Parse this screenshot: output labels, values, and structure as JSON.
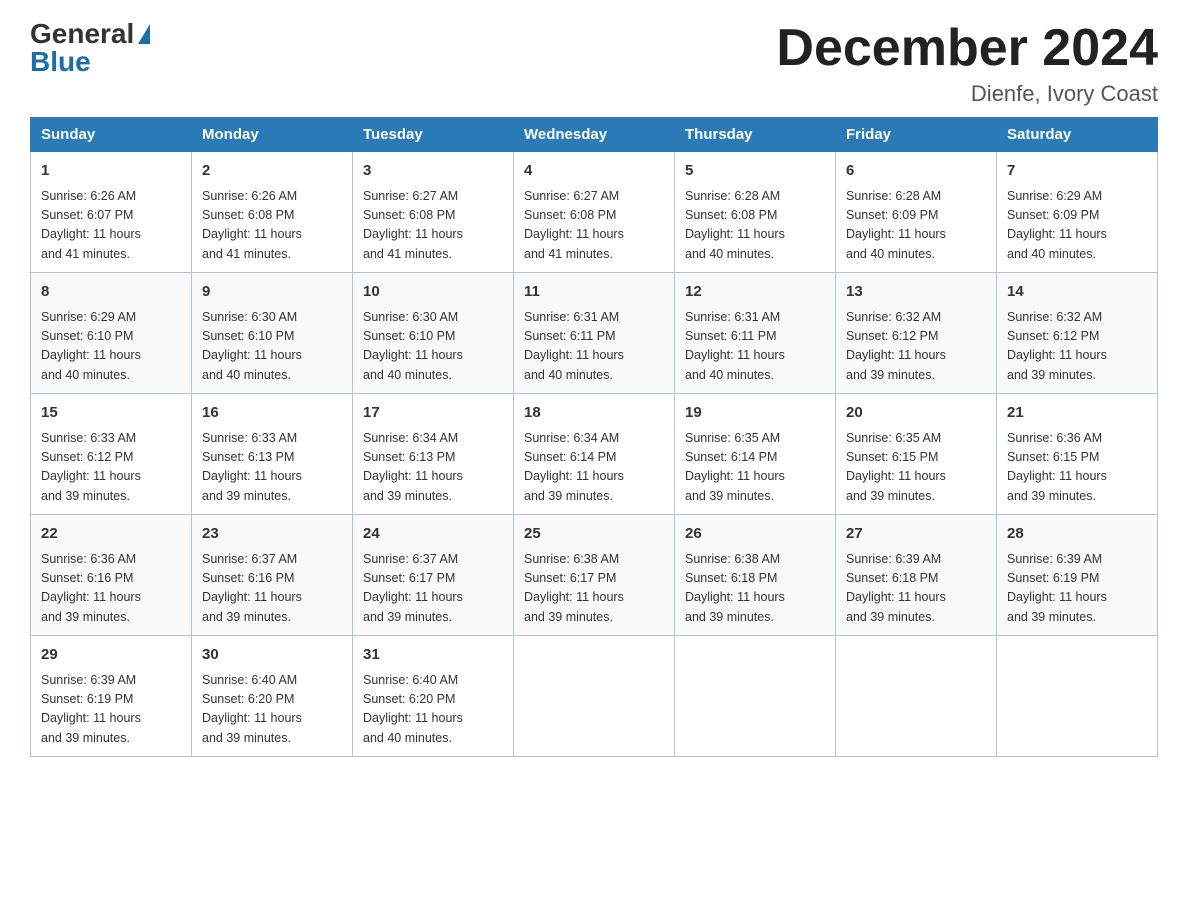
{
  "logo": {
    "general": "General",
    "blue": "Blue"
  },
  "title": "December 2024",
  "location": "Dienfe, Ivory Coast",
  "days_of_week": [
    "Sunday",
    "Monday",
    "Tuesday",
    "Wednesday",
    "Thursday",
    "Friday",
    "Saturday"
  ],
  "weeks": [
    [
      {
        "day": "1",
        "sunrise": "6:26 AM",
        "sunset": "6:07 PM",
        "daylight": "11 hours and 41 minutes."
      },
      {
        "day": "2",
        "sunrise": "6:26 AM",
        "sunset": "6:08 PM",
        "daylight": "11 hours and 41 minutes."
      },
      {
        "day": "3",
        "sunrise": "6:27 AM",
        "sunset": "6:08 PM",
        "daylight": "11 hours and 41 minutes."
      },
      {
        "day": "4",
        "sunrise": "6:27 AM",
        "sunset": "6:08 PM",
        "daylight": "11 hours and 41 minutes."
      },
      {
        "day": "5",
        "sunrise": "6:28 AM",
        "sunset": "6:08 PM",
        "daylight": "11 hours and 40 minutes."
      },
      {
        "day": "6",
        "sunrise": "6:28 AM",
        "sunset": "6:09 PM",
        "daylight": "11 hours and 40 minutes."
      },
      {
        "day": "7",
        "sunrise": "6:29 AM",
        "sunset": "6:09 PM",
        "daylight": "11 hours and 40 minutes."
      }
    ],
    [
      {
        "day": "8",
        "sunrise": "6:29 AM",
        "sunset": "6:10 PM",
        "daylight": "11 hours and 40 minutes."
      },
      {
        "day": "9",
        "sunrise": "6:30 AM",
        "sunset": "6:10 PM",
        "daylight": "11 hours and 40 minutes."
      },
      {
        "day": "10",
        "sunrise": "6:30 AM",
        "sunset": "6:10 PM",
        "daylight": "11 hours and 40 minutes."
      },
      {
        "day": "11",
        "sunrise": "6:31 AM",
        "sunset": "6:11 PM",
        "daylight": "11 hours and 40 minutes."
      },
      {
        "day": "12",
        "sunrise": "6:31 AM",
        "sunset": "6:11 PM",
        "daylight": "11 hours and 40 minutes."
      },
      {
        "day": "13",
        "sunrise": "6:32 AM",
        "sunset": "6:12 PM",
        "daylight": "11 hours and 39 minutes."
      },
      {
        "day": "14",
        "sunrise": "6:32 AM",
        "sunset": "6:12 PM",
        "daylight": "11 hours and 39 minutes."
      }
    ],
    [
      {
        "day": "15",
        "sunrise": "6:33 AM",
        "sunset": "6:12 PM",
        "daylight": "11 hours and 39 minutes."
      },
      {
        "day": "16",
        "sunrise": "6:33 AM",
        "sunset": "6:13 PM",
        "daylight": "11 hours and 39 minutes."
      },
      {
        "day": "17",
        "sunrise": "6:34 AM",
        "sunset": "6:13 PM",
        "daylight": "11 hours and 39 minutes."
      },
      {
        "day": "18",
        "sunrise": "6:34 AM",
        "sunset": "6:14 PM",
        "daylight": "11 hours and 39 minutes."
      },
      {
        "day": "19",
        "sunrise": "6:35 AM",
        "sunset": "6:14 PM",
        "daylight": "11 hours and 39 minutes."
      },
      {
        "day": "20",
        "sunrise": "6:35 AM",
        "sunset": "6:15 PM",
        "daylight": "11 hours and 39 minutes."
      },
      {
        "day": "21",
        "sunrise": "6:36 AM",
        "sunset": "6:15 PM",
        "daylight": "11 hours and 39 minutes."
      }
    ],
    [
      {
        "day": "22",
        "sunrise": "6:36 AM",
        "sunset": "6:16 PM",
        "daylight": "11 hours and 39 minutes."
      },
      {
        "day": "23",
        "sunrise": "6:37 AM",
        "sunset": "6:16 PM",
        "daylight": "11 hours and 39 minutes."
      },
      {
        "day": "24",
        "sunrise": "6:37 AM",
        "sunset": "6:17 PM",
        "daylight": "11 hours and 39 minutes."
      },
      {
        "day": "25",
        "sunrise": "6:38 AM",
        "sunset": "6:17 PM",
        "daylight": "11 hours and 39 minutes."
      },
      {
        "day": "26",
        "sunrise": "6:38 AM",
        "sunset": "6:18 PM",
        "daylight": "11 hours and 39 minutes."
      },
      {
        "day": "27",
        "sunrise": "6:39 AM",
        "sunset": "6:18 PM",
        "daylight": "11 hours and 39 minutes."
      },
      {
        "day": "28",
        "sunrise": "6:39 AM",
        "sunset": "6:19 PM",
        "daylight": "11 hours and 39 minutes."
      }
    ],
    [
      {
        "day": "29",
        "sunrise": "6:39 AM",
        "sunset": "6:19 PM",
        "daylight": "11 hours and 39 minutes."
      },
      {
        "day": "30",
        "sunrise": "6:40 AM",
        "sunset": "6:20 PM",
        "daylight": "11 hours and 39 minutes."
      },
      {
        "day": "31",
        "sunrise": "6:40 AM",
        "sunset": "6:20 PM",
        "daylight": "11 hours and 40 minutes."
      },
      null,
      null,
      null,
      null
    ]
  ],
  "labels": {
    "sunrise": "Sunrise:",
    "sunset": "Sunset:",
    "daylight": "Daylight:"
  }
}
